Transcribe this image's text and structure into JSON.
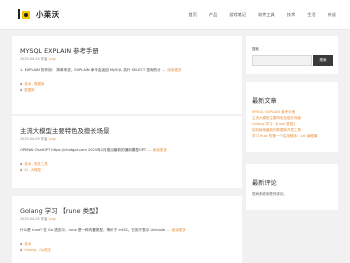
{
  "site": {
    "name": "小莱沃"
  },
  "nav": [
    "首页",
    "产品",
    "游戏笔记",
    "软件工具",
    "技术",
    "生活",
    "杂谈"
  ],
  "posts": [
    {
      "title": "MYSQL EXPLAIN 参考手册",
      "date": "2025-04-15",
      "author_prefix": "作者",
      "author": "Liqo",
      "excerpt": "1. EXPLAIN 的作用：  简单来说，EXPLAIN 命令会返回 MySQL 执行 SELECT 查询的计 ...",
      "more": "阅读更多",
      "categories": [
        "技术",
        "数据库"
      ],
      "tags": [
        "数据库"
      ]
    },
    {
      "title": "主流大模型主要特色及擅长场景",
      "date": "2025-04-09",
      "author_prefix": "作者",
      "author": "Liqo",
      "excerpt": "OPENAI ChatGPT https://chatgpt.com 2025年2月推出最新的通用模型GPT ...",
      "more": "阅读更多",
      "categories": [
        "技术",
        "软件工具"
      ],
      "tags": [
        "AI",
        "大模型"
      ]
    },
    {
      "title": "Golang 学习 【rune 类型】",
      "date": "2025-04-05",
      "author_prefix": "作者",
      "author": "Liqo",
      "excerpt": "什么是 rune?  在 Go 语言中，rune 是一种内置类型，等价于 int32。它用于表示 Unicode ...",
      "more": "阅读更多",
      "categories": [
        "技术"
      ],
      "tags": [
        "Golang",
        "Go语法"
      ]
    }
  ],
  "sidebar": {
    "search_label": "搜索",
    "search_placeholder": "",
    "search_button": "搜索",
    "recent_title": "最新文章",
    "recent_posts": [
      "MYSQL EXPLAIN 参考手册",
      "主流大模型主要特色及擅长场景",
      "Golang 学习 【rune 类型】",
      "如何使用最新的数据库开发工具",
      "学习 Rust 的第一个实用程序：cat 编程篇"
    ],
    "comments_title": "最新评论",
    "comments_text": "您尚未收到任何评论。"
  },
  "colors": {
    "accent": "#e88f3a",
    "logo_yellow": "#f5c400"
  }
}
